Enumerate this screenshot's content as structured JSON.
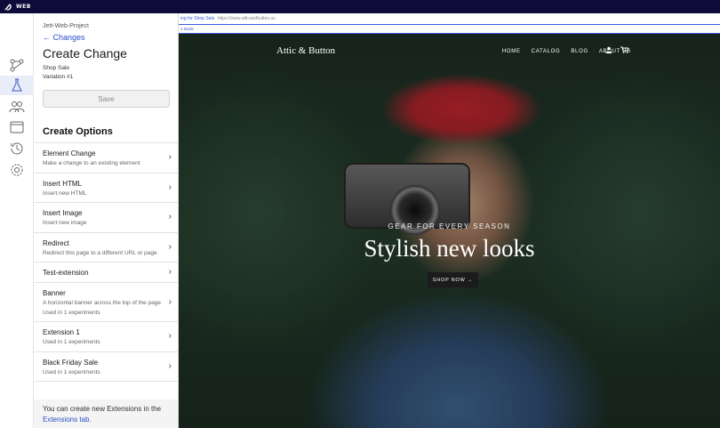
{
  "app": {
    "brand": "WEB"
  },
  "rail": {
    "items": [
      {
        "name": "experiments-icon"
      },
      {
        "name": "flask-icon"
      },
      {
        "name": "audience-icon"
      },
      {
        "name": "window-icon"
      },
      {
        "name": "history-icon"
      },
      {
        "name": "settings-icon"
      }
    ],
    "active_index": 1
  },
  "panel": {
    "project": "Jett-Web-Project",
    "back_label": "← Changes",
    "title": "Create Change",
    "experiment": "Shop Sale",
    "variation": "Variation #1",
    "save_label": "Save",
    "options_heading": "Create Options",
    "options": [
      {
        "title": "Element Change",
        "desc": "Make a change to an existing element"
      },
      {
        "title": "Insert HTML",
        "desc": "Insert new HTML"
      },
      {
        "title": "Insert Image",
        "desc": "Insert new image"
      },
      {
        "title": "Redirect",
        "desc": "Redirect this page to a different URL or page"
      },
      {
        "title": "Test-extension",
        "desc": ""
      },
      {
        "title": "Banner",
        "desc": "A horizontal banner across the top of the page",
        "usage": "Used in 1 experiments"
      },
      {
        "title": "Extension 1",
        "desc": "Used in 1 experiments"
      },
      {
        "title": "Black Friday Sale",
        "desc": "Used in 1 experiments"
      }
    ],
    "footer_text": "You can create new Extensions in the",
    "footer_link": "Extensions tab."
  },
  "preview": {
    "editing_label": "ing for Shop Sale",
    "editing_url": "https://www.atticandbutton.us",
    "sub_label": "e Mode",
    "site_logo": "Attic & Button",
    "nav": [
      "HOME",
      "CATALOG",
      "BLOG",
      "ABOUT US"
    ],
    "tagline": "GEAR FOR EVERY SEASON",
    "headline": "Stylish new looks",
    "cta": "SHOP NOW →"
  }
}
